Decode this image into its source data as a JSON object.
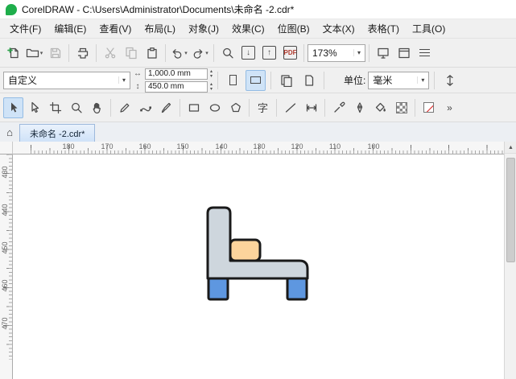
{
  "window": {
    "title": "CorelDRAW - C:\\Users\\Administrator\\Documents\\未命名 -2.cdr*"
  },
  "menu": {
    "items": [
      "文件(F)",
      "编辑(E)",
      "查看(V)",
      "布局(L)",
      "对象(J)",
      "效果(C)",
      "位图(B)",
      "文本(X)",
      "表格(T)",
      "工具(O)"
    ]
  },
  "toolbar": {
    "pdf_label": "PDF",
    "zoom_level": "173%"
  },
  "property_bar": {
    "preset": "自定义",
    "page_width": "1,000.0 mm",
    "page_height": "450.0 mm",
    "units_label": "单位:",
    "units_value": "毫米"
  },
  "toolbox": {
    "text_tool_label": "字"
  },
  "tabbar": {
    "document_tab": "未命名 -2.cdr*"
  },
  "rulers": {
    "horizontal": [
      "180",
      "170",
      "160",
      "150",
      "140",
      "130",
      "120",
      "110",
      "100"
    ],
    "vertical": [
      "430",
      "440",
      "450",
      "460",
      "470"
    ]
  },
  "icons": {
    "dropdown_arrow": "▾",
    "import_arrow": "↓",
    "export_arrow": "↑",
    "home": "⌂",
    "scroll_up": "▲",
    "width_arrow": "↔",
    "height_arrow": "↕",
    "spin_up": "▴",
    "spin_down": "▾",
    "overflow_chevron": "»"
  },
  "canvas": {
    "colors": {
      "frame": "#ced6dd",
      "cushion": "#fcd49c",
      "legs": "#5e97e0",
      "outline": "#1a1a1a"
    }
  }
}
